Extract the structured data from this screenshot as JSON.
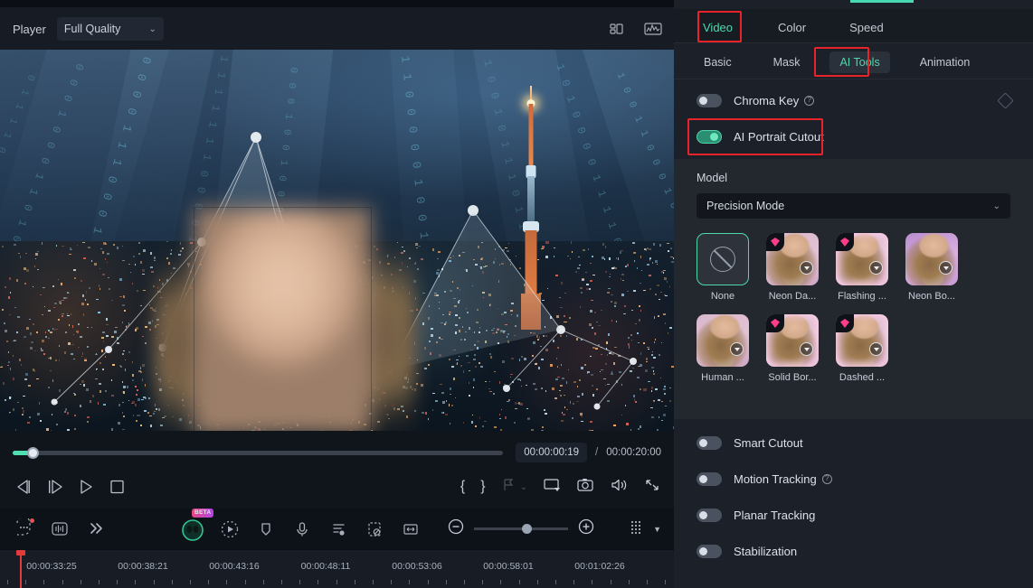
{
  "player": {
    "label": "Player",
    "quality": "Full Quality",
    "quality_chevron": "chevron-down-icon",
    "icons": [
      "layout-grid-icon",
      "scope-waveform-icon"
    ],
    "current_time": "00:00:00:19",
    "time_separator": "/",
    "total_time": "00:00:20:00",
    "transport": [
      {
        "name": "prev-frame-button",
        "glyph": "prev-frame-icon"
      },
      {
        "name": "next-frame-button",
        "glyph": "next-frame-icon"
      },
      {
        "name": "play-button",
        "glyph": "play-icon"
      },
      {
        "name": "stop-button",
        "glyph": "stop-icon"
      }
    ],
    "right_controls": [
      {
        "name": "mark-in-button",
        "label": "{"
      },
      {
        "name": "mark-out-button",
        "label": "}"
      },
      {
        "name": "markers-button",
        "label": ""
      },
      {
        "name": "markers-dropdown",
        "label": ""
      },
      {
        "name": "display-mode-button",
        "label": ""
      },
      {
        "name": "snapshot-button",
        "label": ""
      },
      {
        "name": "volume-button",
        "label": ""
      },
      {
        "name": "fullscreen-button",
        "label": ""
      }
    ]
  },
  "toolbar": {
    "items": [
      {
        "name": "speech-bubble-tool",
        "badge": "dot"
      },
      {
        "name": "audio-waveform-tool"
      },
      {
        "name": "expand-tool"
      },
      {
        "name": "ai-assistant-tool",
        "badge": "BETA"
      },
      {
        "name": "ai-effects-tool"
      },
      {
        "name": "marker-tool"
      },
      {
        "name": "record-voiceover-tool"
      },
      {
        "name": "auto-subtitle-tool"
      },
      {
        "name": "remove-background-tool"
      },
      {
        "name": "fit-timeline-tool"
      }
    ],
    "zoom_out": "zoom-out-icon",
    "zoom_in": "zoom-in-icon",
    "zoom_value": 56,
    "grid_view": "grid-view-icon",
    "grid_dropdown": "chevron-down-icon"
  },
  "timeline": {
    "ticks": [
      "00:00:33:25",
      "00:00:38:21",
      "00:00:43:16",
      "00:00:48:11",
      "00:00:53:06",
      "00:00:58:01",
      "00:01:02:26"
    ]
  },
  "panel": {
    "main_tabs": [
      {
        "label": "Video",
        "active": true,
        "highlighted": true
      },
      {
        "label": "Color",
        "active": false,
        "highlighted": false
      },
      {
        "label": "Speed",
        "active": false,
        "highlighted": false
      }
    ],
    "sub_tabs": [
      {
        "label": "Basic",
        "active": false,
        "highlighted": false
      },
      {
        "label": "Mask",
        "active": false,
        "highlighted": false
      },
      {
        "label": "AI Tools",
        "active": true,
        "highlighted": true
      },
      {
        "label": "Animation",
        "active": false,
        "highlighted": false
      }
    ],
    "chroma_key": {
      "label": "Chroma Key",
      "enabled": false,
      "has_help": true,
      "keyframe_icon": "diamond-keyframe-icon"
    },
    "ai_portrait_cutout": {
      "label": "AI Portrait Cutout",
      "enabled": true,
      "has_help": false,
      "highlighted": true
    },
    "model": {
      "label": "Model",
      "value": "Precision Mode",
      "chevron": "chevron-down-icon"
    },
    "presets": [
      {
        "name": "None",
        "selected": true,
        "pro": false,
        "download": false,
        "style": "none"
      },
      {
        "name": "Neon Da...",
        "selected": false,
        "pro": true,
        "download": true,
        "style": "pink"
      },
      {
        "name": "Flashing ...",
        "selected": false,
        "pro": true,
        "download": true,
        "style": "pink-glow"
      },
      {
        "name": "Neon Bo...",
        "selected": false,
        "pro": false,
        "download": true,
        "style": "purple"
      },
      {
        "name": "Human ...",
        "selected": false,
        "pro": false,
        "download": true,
        "style": "pink"
      },
      {
        "name": "Solid Bor...",
        "selected": false,
        "pro": true,
        "download": true,
        "style": "pink-glow"
      },
      {
        "name": "Dashed ...",
        "selected": false,
        "pro": true,
        "download": true,
        "style": "pink-glow"
      }
    ],
    "bottom_toggles": [
      {
        "label": "Smart Cutout",
        "enabled": false,
        "has_help": false
      },
      {
        "label": "Motion Tracking",
        "enabled": false,
        "has_help": true
      },
      {
        "label": "Planar Tracking",
        "enabled": false,
        "has_help": false
      },
      {
        "label": "Stabilization",
        "enabled": false,
        "has_help": false
      }
    ]
  },
  "colors": {
    "accent_green": "#4ed8ab",
    "highlight_red": "#e8242a",
    "panel_bg": "#1c2028",
    "section_bg": "#23282f",
    "pro_badge": "#ff3d8a"
  }
}
